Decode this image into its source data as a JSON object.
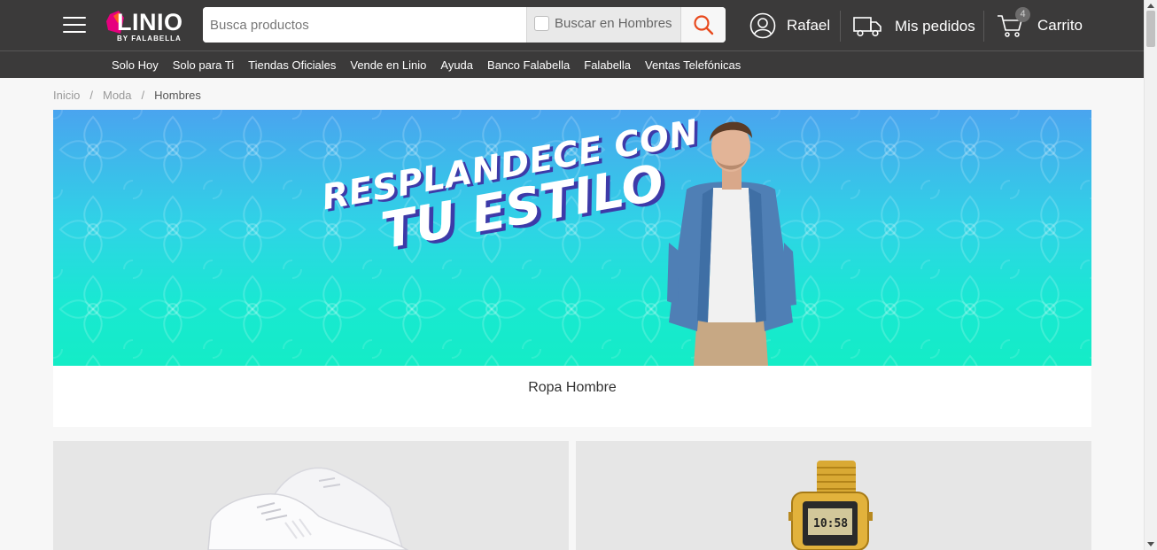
{
  "header": {
    "logo_text": "LINIO",
    "logo_subtext": "BY FALABELLA",
    "search_placeholder": "Busca productos",
    "search_scope_label": "Buscar en Hombres",
    "user_name": "Rafael",
    "orders_label": "Mis pedidos",
    "cart_label": "Carrito",
    "cart_count": "4"
  },
  "subnav": {
    "items": [
      "Solo Hoy",
      "Solo para Ti",
      "Tiendas Oficiales",
      "Vende en Linio",
      "Ayuda",
      "Banco Falabella",
      "Falabella",
      "Ventas Telefónicas"
    ]
  },
  "breadcrumb": {
    "items": [
      "Inicio",
      "Moda",
      "Hombres"
    ],
    "separator": "/"
  },
  "hero": {
    "headline_line1": "RESPLANDECE CON",
    "headline_line2": "TU ESTILO",
    "caption": "Ropa Hombre"
  },
  "colors": {
    "header_bg": "#3b3a3a",
    "accent": "#e8491d",
    "page_bg": "#f7f7f7"
  },
  "icons": {
    "menu": "hamburger-icon",
    "search": "search-icon",
    "user": "user-icon",
    "orders": "truck-icon",
    "cart": "cart-icon"
  }
}
